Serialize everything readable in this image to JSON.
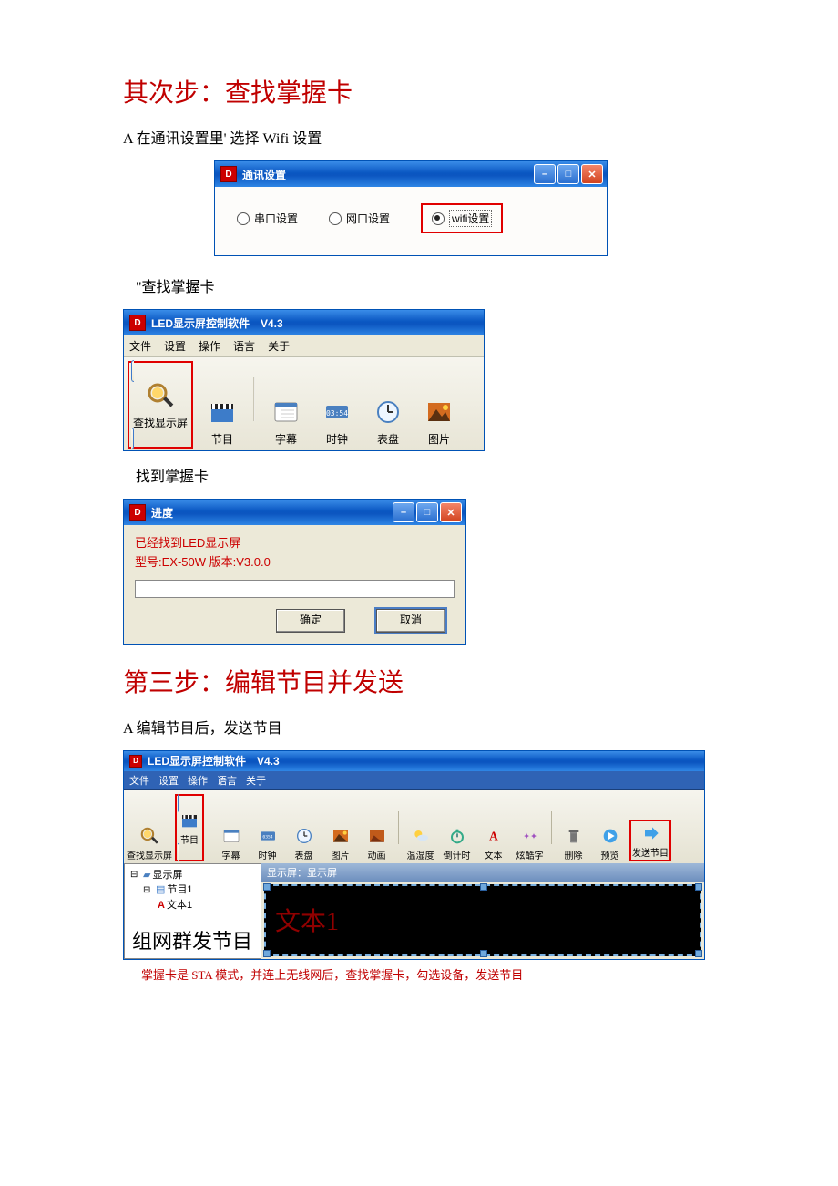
{
  "heading1": "其次步：查找掌握卡",
  "para1_a": "A 在通讯设置里' 选择 Wifi 设置",
  "dialog1": {
    "title": "通讯设置",
    "radio_serial": "串口设置",
    "radio_net": "网口设置",
    "radio_wifi": "wifi设置"
  },
  "para2": "\"查找掌握卡",
  "win2": {
    "title": "LED显示屏控制软件　V4.3",
    "menu": {
      "file": "文件",
      "settings": "设置",
      "operate": "操作",
      "lang": "语言",
      "about": "关于"
    },
    "tb": {
      "find": "查找显示屏",
      "program": "节目",
      "subtitle": "字幕",
      "clock": "时钟",
      "dial": "表盘",
      "image": "图片"
    }
  },
  "para3": "找到掌握卡",
  "dialog3": {
    "title": "进度",
    "line1": "已经找到LED显示屏",
    "line2": "型号:EX-50W 版本:V3.0.0",
    "ok": "确定",
    "cancel": "取消"
  },
  "heading2": "第三步：编辑节目并发送",
  "para4": "A 编辑节目后，发送节目",
  "win4": {
    "title": "LED显示屏控制软件　V4.3",
    "menu": {
      "file": "文件",
      "settings": "设置",
      "operate": "操作",
      "lang": "语言",
      "about": "关于"
    },
    "tb": {
      "find": "查找显示屏",
      "program": "节目",
      "subtitle": "字幕",
      "clock": "时钟",
      "dial": "表盘",
      "image": "图片",
      "anim": "动画",
      "temp": "温湿度",
      "countdown": "倒计时",
      "text": "文本",
      "fancy": "炫酷字",
      "delete": "删除",
      "preview": "预览",
      "send": "发送节目"
    },
    "tree": {
      "root": "显示屏",
      "prog": "节目1",
      "text": "文本1"
    },
    "canvas_title": "显示屏：显示屏",
    "led_sample": "文本1",
    "overlay": "组网群发节目"
  },
  "caption": "掌握卡是 STA 模式，并连上无线网后，查找掌握卡，勾选设备，发送节目"
}
